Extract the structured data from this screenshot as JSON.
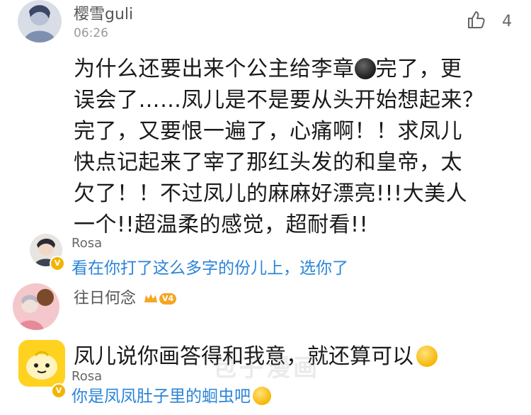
{
  "comment": {
    "username": "樱雪guli",
    "time": "06:26",
    "like_count": "4",
    "lines": [
      "为什么还要出来个公主给李章",
      "完了，更",
      "误会了……凤儿是不是要从头开始想起来？",
      "完了，又要恨一遍了，心痛啊！！求凤儿",
      "快点记起来了宰了那红头发的和皇帝，太",
      "欠了！！不过凤儿的麻麻好漂亮!!!大美人",
      "一个!!超温柔的感觉，超耐看!!"
    ]
  },
  "reply1": {
    "username": "Rosa",
    "text": "看在你打了这么多字的份儿上，选你了"
  },
  "comment2": {
    "username": "往日何念",
    "level": "V4",
    "text": "凤儿说你画答得和我意，就还算可以"
  },
  "reply2": {
    "username": "Rosa",
    "text": "你是凤凤肚子里的蛔虫吧"
  },
  "watermark": "包子漫画",
  "icons": {
    "like": "thumbs-up-icon",
    "verified": "verified-v-icon",
    "crown": "crown-icon"
  }
}
